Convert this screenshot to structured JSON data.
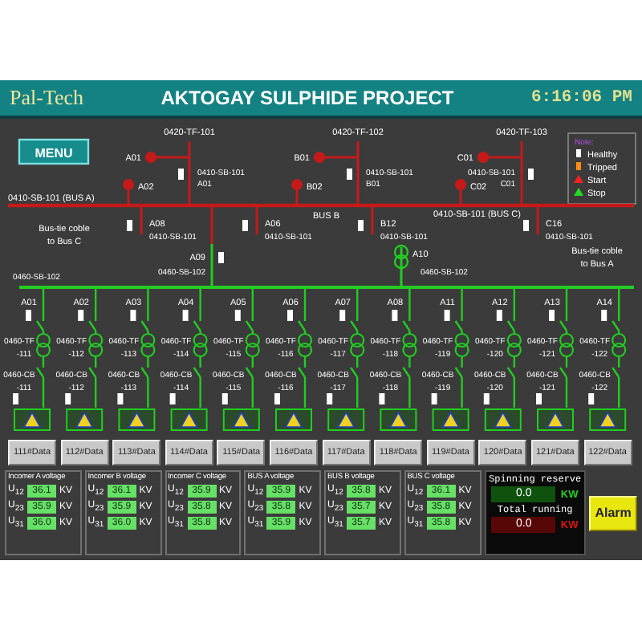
{
  "header": {
    "logo": "Pal-Tech",
    "title": "AKTOGAY SULPHIDE PROJECT",
    "time": "6:16:06 PM"
  },
  "menu_button": "MENU",
  "legend": {
    "title": "Note:",
    "items": [
      {
        "label": "Healthy",
        "kind": "square",
        "color": "#ffffff"
      },
      {
        "label": "Tripped",
        "kind": "square",
        "color": "#ff8a1a"
      },
      {
        "label": "Start",
        "kind": "triangle",
        "color": "#ff2020"
      },
      {
        "label": "Stop",
        "kind": "triangle",
        "color": "#22dd22"
      }
    ]
  },
  "incomers": [
    {
      "transformer": "0420-TF-101",
      "breaker_top": "A01",
      "switchboard": "0410-SB-101",
      "switchboard_id": "A01",
      "breaker_bottom": "A02"
    },
    {
      "transformer": "0420-TF-102",
      "breaker_top": "B01",
      "switchboard": "0410-SB-101",
      "switchboard_id": "B01",
      "breaker_bottom": "B02"
    },
    {
      "transformer": "0420-TF-103",
      "breaker_top": "C01",
      "switchboard": "0410-SB-101",
      "switchboard_id": "C01",
      "breaker_bottom": "C02"
    }
  ],
  "bus_labels": [
    "0410-SB-101 (BUS A)",
    "BUS B",
    "0410-SB-101 (BUS C)"
  ],
  "couplers": [
    {
      "id": "A08",
      "board": "0410-SB-101"
    },
    {
      "id": "A06",
      "board": "0410-SB-101"
    },
    {
      "id": "B12",
      "board": "0410-SB-101"
    },
    {
      "id": "C16",
      "board": "0410-SB-101"
    }
  ],
  "bus_ties": [
    {
      "line1": "Bus-tie coble",
      "line2": "to Bus C"
    },
    {
      "line1": "Bus-tie coble",
      "line2": "to Bus A"
    }
  ],
  "lv_incomers": [
    {
      "id": "A09",
      "board": "0460-SB-102"
    },
    {
      "id": "A10",
      "board": "0460-SB-102"
    }
  ],
  "lv_bus_label": "0460-SB-102",
  "feeders": [
    {
      "id": "A01",
      "transformer": "0460-TF",
      "transformer_no": "-111",
      "breaker": "0460-CB",
      "breaker_no": "-111",
      "button": "111#Data"
    },
    {
      "id": "A02",
      "transformer": "0460-TF",
      "transformer_no": "-112",
      "breaker": "0460-CB",
      "breaker_no": "-112",
      "button": "112#Data"
    },
    {
      "id": "A03",
      "transformer": "0460-TF",
      "transformer_no": "-113",
      "breaker": "0460-CB",
      "breaker_no": "-113",
      "button": "113#Data"
    },
    {
      "id": "A04",
      "transformer": "0460-TF",
      "transformer_no": "-114",
      "breaker": "0460-CB",
      "breaker_no": "-114",
      "button": "114#Data"
    },
    {
      "id": "A05",
      "transformer": "0460-TF",
      "transformer_no": "-115",
      "breaker": "0460-CB",
      "breaker_no": "-115",
      "button": "115#Data"
    },
    {
      "id": "A06",
      "transformer": "0460-TF",
      "transformer_no": "-116",
      "breaker": "0460-CB",
      "breaker_no": "-116",
      "button": "116#Data"
    },
    {
      "id": "A07",
      "transformer": "0460-TF",
      "transformer_no": "-117",
      "breaker": "0460-CB",
      "breaker_no": "-117",
      "button": "117#Data"
    },
    {
      "id": "A08",
      "transformer": "0460-TF",
      "transformer_no": "-118",
      "breaker": "0460-CB",
      "breaker_no": "-118",
      "button": "118#Data"
    },
    {
      "id": "A11",
      "transformer": "0460-TF",
      "transformer_no": "-119",
      "breaker": "0460-CB",
      "breaker_no": "-119",
      "button": "119#Data"
    },
    {
      "id": "A12",
      "transformer": "0460-TF",
      "transformer_no": "-120",
      "breaker": "0460-CB",
      "breaker_no": "-120",
      "button": "120#Data"
    },
    {
      "id": "A13",
      "transformer": "0460-TF",
      "transformer_no": "-121",
      "breaker": "0460-CB",
      "breaker_no": "-121",
      "button": "121#Data"
    },
    {
      "id": "A14",
      "transformer": "0460-TF",
      "transformer_no": "-122",
      "breaker": "0460-CB",
      "breaker_no": "-122",
      "button": "122#Data"
    }
  ],
  "voltage_panels": [
    {
      "title": "Incomer A voltage",
      "readings": [
        {
          "label": "U$_{12}$",
          "value": "36.1",
          "unit": "KV"
        },
        {
          "label": "U$_{23}$",
          "value": "35.9",
          "unit": "KV"
        },
        {
          "label": "U$_{31}$",
          "value": "36.0",
          "unit": "KV"
        }
      ]
    },
    {
      "title": "Incomer B voltage",
      "readings": [
        {
          "label": "U$_{12}$",
          "value": "36.1",
          "unit": "KV"
        },
        {
          "label": "U$_{23}$",
          "value": "35.9",
          "unit": "KV"
        },
        {
          "label": "U$_{31}$",
          "value": "36.0",
          "unit": "KV"
        }
      ]
    },
    {
      "title": "Incomer C voltage",
      "readings": [
        {
          "label": "U$_{12}$",
          "value": "35.9",
          "unit": "KV"
        },
        {
          "label": "U$_{23}$",
          "value": "35.8",
          "unit": "KV"
        },
        {
          "label": "U$_{31}$",
          "value": "35.8",
          "unit": "KV"
        }
      ]
    },
    {
      "title": "BUS A voltage",
      "readings": [
        {
          "label": "U$_{12}$",
          "value": "35.9",
          "unit": "KV"
        },
        {
          "label": "U$_{23}$",
          "value": "35.8",
          "unit": "KV"
        },
        {
          "label": "U$_{31}$",
          "value": "35.9",
          "unit": "KV"
        }
      ]
    },
    {
      "title": "BUS B voltage",
      "readings": [
        {
          "label": "U$_{12}$",
          "value": "35.8",
          "unit": "KV"
        },
        {
          "label": "U$_{23}$",
          "value": "35.7",
          "unit": "KV"
        },
        {
          "label": "U$_{31}$",
          "value": "35.7",
          "unit": "KV"
        }
      ]
    },
    {
      "title": "BUS C voltage",
      "readings": [
        {
          "label": "U$_{12}$",
          "value": "36.1",
          "unit": "KV"
        },
        {
          "label": "U$_{23}$",
          "value": "35.8",
          "unit": "KV"
        },
        {
          "label": "U$_{31}$",
          "value": "35.8",
          "unit": "KV"
        }
      ]
    }
  ],
  "totals": [
    {
      "label": "Spinning reserve",
      "value": "0.0",
      "unit": "KW",
      "color": "#22cc22"
    },
    {
      "label": "Total running",
      "value": "0.0",
      "unit": "KW",
      "color": "#dd1111"
    }
  ],
  "alarm_button": "Alarm"
}
